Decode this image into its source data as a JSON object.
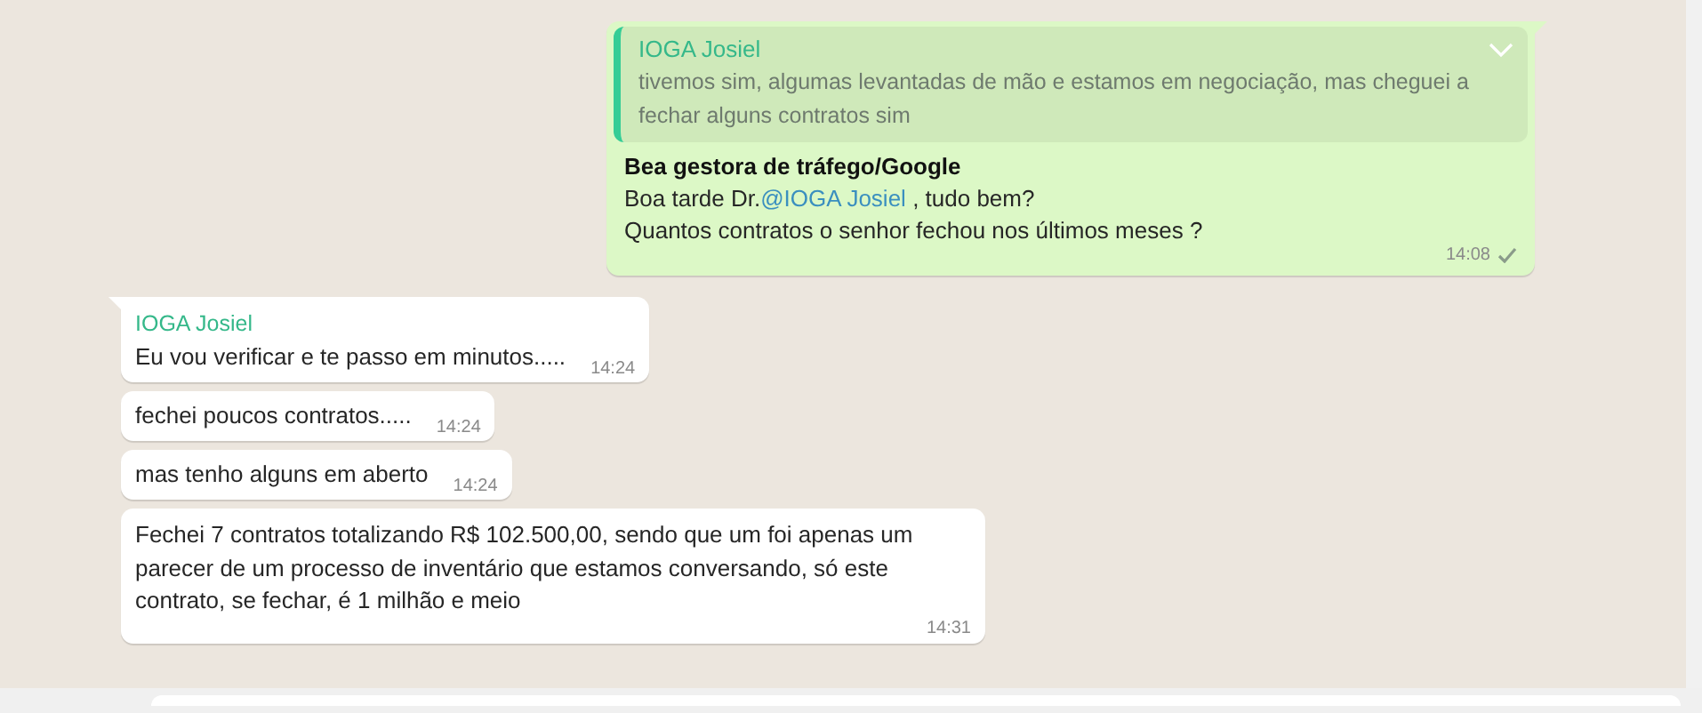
{
  "messages": [
    {
      "outgoing": true,
      "tail": true,
      "sent": true,
      "time": "14:08",
      "quote": {
        "author": "IOGA Josiel",
        "text": "tivemos sim, algumas levantadas de mão e estamos em negociação, mas cheguei a fechar alguns contratos sim"
      },
      "sender": "Bea gestora de tráfego/Google",
      "lines": [
        [
          {
            "kind": "text",
            "text": "Boa tarde Dr."
          },
          {
            "kind": "mention",
            "text": "@IOGA Josiel"
          },
          {
            "kind": "text",
            "text": " , tudo bem?"
          }
        ],
        [
          {
            "kind": "text",
            "text": "Quantos contratos o senhor fechou nos últimos meses ?"
          }
        ]
      ]
    },
    {
      "outgoing": false,
      "tail": true,
      "time": "14:24",
      "sender": "IOGA Josiel",
      "lines": [
        [
          {
            "kind": "text",
            "text": "Eu vou verificar e te passo em minutos....."
          }
        ]
      ]
    },
    {
      "outgoing": false,
      "tail": false,
      "time": "14:24",
      "lines": [
        [
          {
            "kind": "text",
            "text": "fechei poucos contratos....."
          }
        ]
      ]
    },
    {
      "outgoing": false,
      "tail": false,
      "time": "14:24",
      "lines": [
        [
          {
            "kind": "text",
            "text": "mas tenho alguns em aberto"
          }
        ]
      ]
    },
    {
      "outgoing": false,
      "tail": false,
      "time": "14:31",
      "lines": [
        [
          {
            "kind": "text",
            "text": "Fechei 7 contratos totalizando R$ 102.500,00, sendo que um foi apenas  um parecer de um processo de inventário que estamos conversando, só este contrato, se fechar, é 1 milhão e meio"
          }
        ]
      ]
    }
  ]
}
